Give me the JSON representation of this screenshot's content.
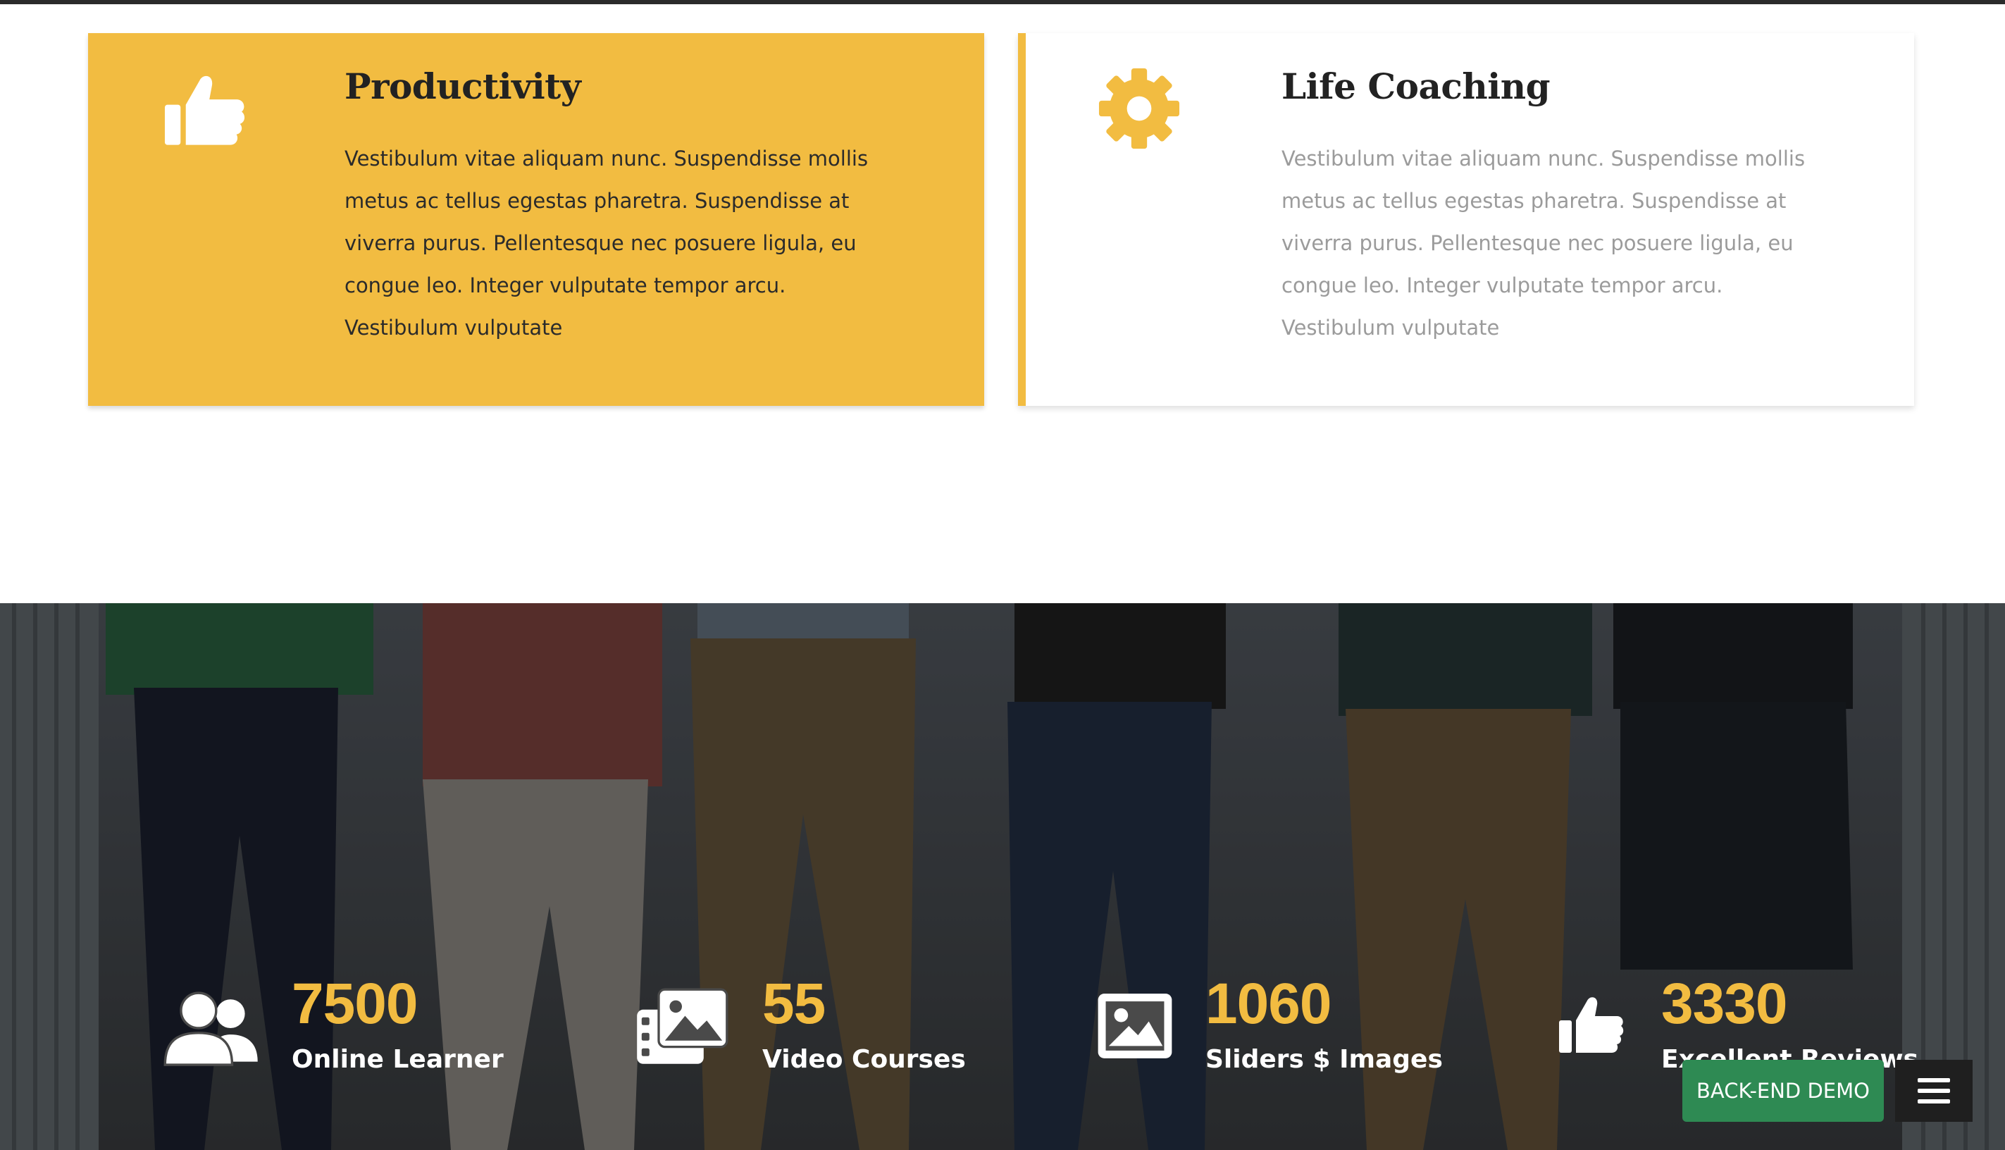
{
  "cards": [
    {
      "title": "Productivity",
      "text": "Vestibulum vitae aliquam nunc. Suspendisse mollis metus ac tellus egestas pharetra. Suspendisse at viverra purus. Pellentesque nec posuere ligula, eu congue leo. Integer vulputate tempor arcu. Vestibulum vulputate",
      "icon": "thumbs-up-icon",
      "background": "#f2bc41"
    },
    {
      "title": "Life Coaching",
      "text": "Vestibulum vitae aliquam nunc. Suspendisse mollis metus ac tellus egestas pharetra. Suspendisse at viverra purus. Pellentesque nec posuere ligula, eu congue leo. Integer vulputate tempor arcu. Vestibulum vulputate",
      "icon": "gear-icon",
      "accent": "#f2bc41"
    }
  ],
  "stats": [
    {
      "number": "7500",
      "label": "Online Learner",
      "icon": "users-icon"
    },
    {
      "number": "55",
      "label": "Video Courses",
      "icon": "photo-gallery-icon"
    },
    {
      "number": "1060",
      "label": "Sliders $ Images",
      "icon": "image-icon"
    },
    {
      "number": "3330",
      "label": "Excellent Reviews",
      "icon": "thumbs-up-icon"
    }
  ],
  "buttons": {
    "backend_demo": "BACK-END DEMO",
    "menu_icon": "hamburger-menu-icon"
  },
  "colors": {
    "accent": "#f2bc41",
    "demo_button": "#2e8a53",
    "menu_button": "#1f1f1f"
  }
}
